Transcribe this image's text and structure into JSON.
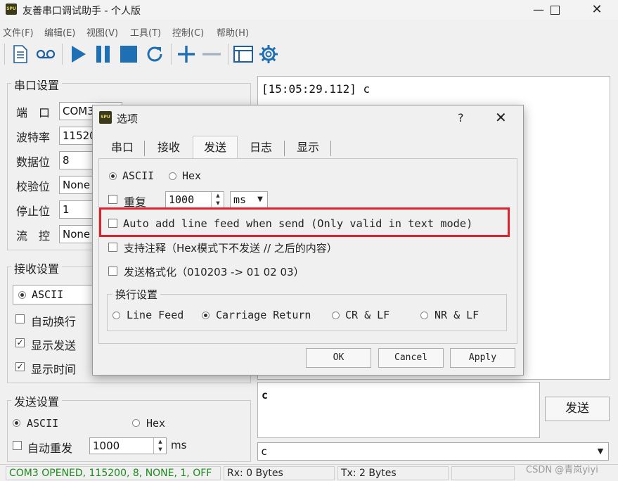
{
  "window": {
    "title": "友善串口调试助手 - 个人版",
    "icon_text": "SPU"
  },
  "menu": [
    "文件(F)",
    "编辑(E)",
    "视图(V)",
    "工具(T)",
    "控制(C)",
    "帮助(H)"
  ],
  "serial": {
    "group_title": "串口设置",
    "rows": [
      {
        "label": "端　口",
        "value": "COM3"
      },
      {
        "label": "波特率",
        "value": "115200"
      },
      {
        "label": "数据位",
        "value": "8"
      },
      {
        "label": "校验位",
        "value": "None"
      },
      {
        "label": "停止位",
        "value": "1"
      },
      {
        "label": "流　控",
        "value": "None"
      }
    ]
  },
  "receive": {
    "group_title": "接收设置",
    "ascii": "ASCII",
    "opt1": "自动换行",
    "opt1_checked": false,
    "opt2": "显示发送",
    "opt2_checked": true,
    "opt3": "显示时间",
    "opt3_checked": true
  },
  "send": {
    "group_title": "发送设置",
    "ascii": "ASCII",
    "hex": "Hex",
    "auto_resend": "自动重发",
    "interval": "1000",
    "unit": "ms"
  },
  "receive_area": {
    "line": "[15:05:29.112] c"
  },
  "send_area": {
    "text": "c",
    "button": "发送",
    "history": "c"
  },
  "dialog": {
    "title": "选项",
    "help": "?",
    "tabs": [
      "串口",
      "接收",
      "发送",
      "日志",
      "显示"
    ],
    "active_tab": 2,
    "ascii": "ASCII",
    "hex": "Hex",
    "repeat_label": "重复",
    "repeat_value": "1000",
    "repeat_unit": "ms",
    "auto_lf": "Auto add line feed when send (Only valid in text mode)",
    "comment": "支持注释（Hex模式下不发送 // 之后的内容）",
    "format": "发送格式化（010203 -> 01 02 03）",
    "newline_group": "换行设置",
    "nl_options": [
      "Line Feed",
      "Carriage Return",
      "CR & LF",
      "NR & LF"
    ],
    "nl_selected": 1,
    "ok": "OK",
    "cancel": "Cancel",
    "apply": "Apply",
    "highlight_color": "#e0202a"
  },
  "status": {
    "port": "COM3 OPENED, 115200, 8, NONE, 1, OFF",
    "rx": "Rx: 0 Bytes",
    "tx": "Tx: 2 Bytes",
    "port_color": "#1a8a1a"
  },
  "watermark": "CSDN @青岚yiyi"
}
